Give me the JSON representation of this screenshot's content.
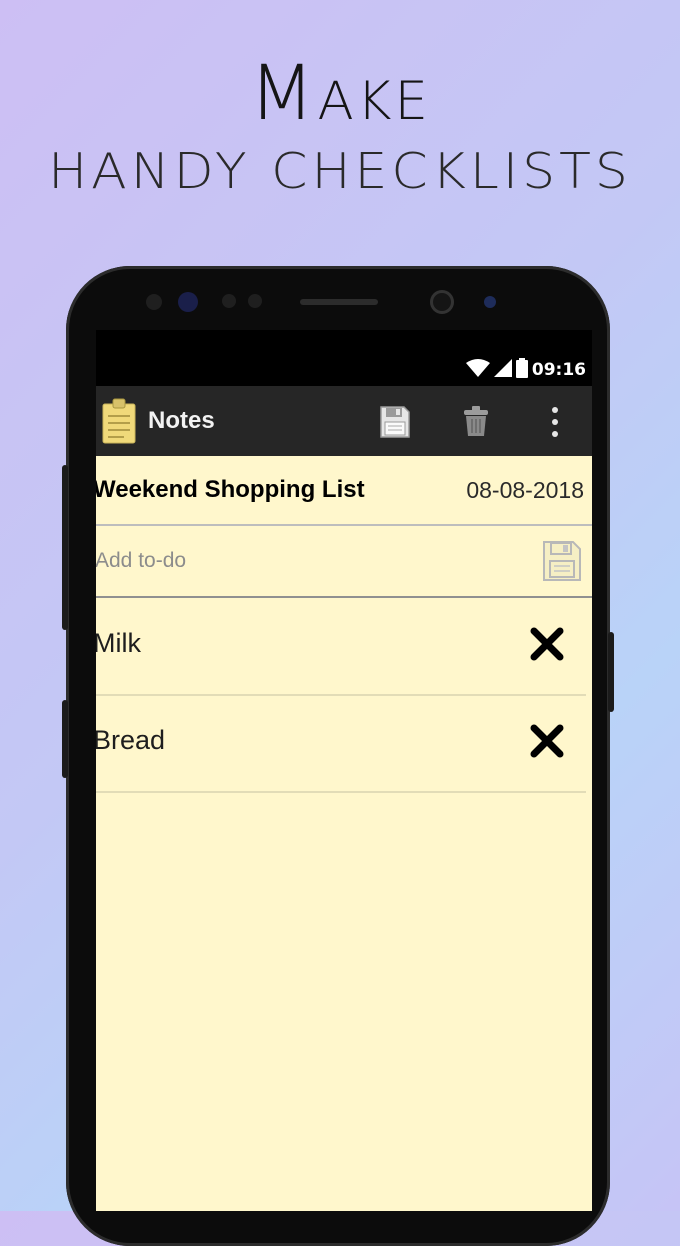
{
  "promo": {
    "title": "Make",
    "subtitle": "handy checklists"
  },
  "status_bar": {
    "time": "09:16"
  },
  "app_bar": {
    "title": "Notes"
  },
  "note": {
    "title": "Weekend Shopping List",
    "date": "08-08-2018"
  },
  "add_todo": {
    "placeholder": "Add to-do",
    "value": ""
  },
  "todos": [
    {
      "label": "Milk"
    },
    {
      "label": "Bread"
    }
  ],
  "icons": {
    "app": "notepad-icon",
    "save": "floppy-disk-icon",
    "delete": "trash-icon",
    "more": "more-vert-icon",
    "remove_item": "close-icon"
  },
  "colors": {
    "note_background": "#fff7cc",
    "app_bar": "#262626",
    "status_bar": "#000000",
    "app_icon": "#f0d97a"
  }
}
